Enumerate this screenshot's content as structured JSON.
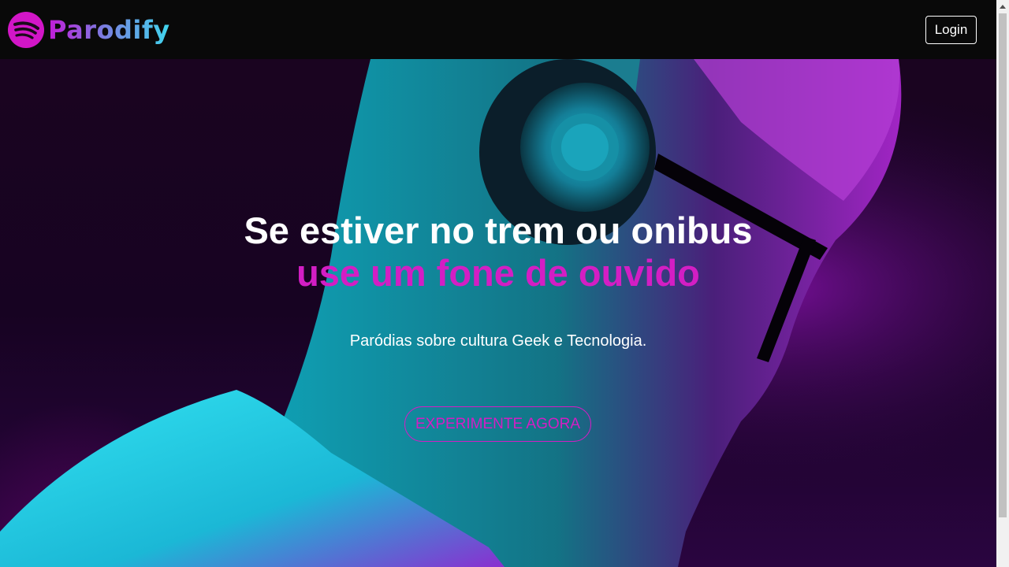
{
  "brand": {
    "name": "Parodify",
    "icon": "spotify-like-logo-icon"
  },
  "nav": {
    "login_label": "Login"
  },
  "hero": {
    "headline_line1": "Se estiver no trem ou onibus",
    "headline_line2": "use um fone de ouvido",
    "subtitle": "Paródias sobre cultura Geek e Tecnologia.",
    "cta_label": "EXPERIMENTE AGORA",
    "image": "man-with-headphones-neon-photo"
  },
  "colors": {
    "accent_pink": "#d31ec4",
    "accent_cyan": "#3fd7ee",
    "navbar_bg": "#090909"
  }
}
